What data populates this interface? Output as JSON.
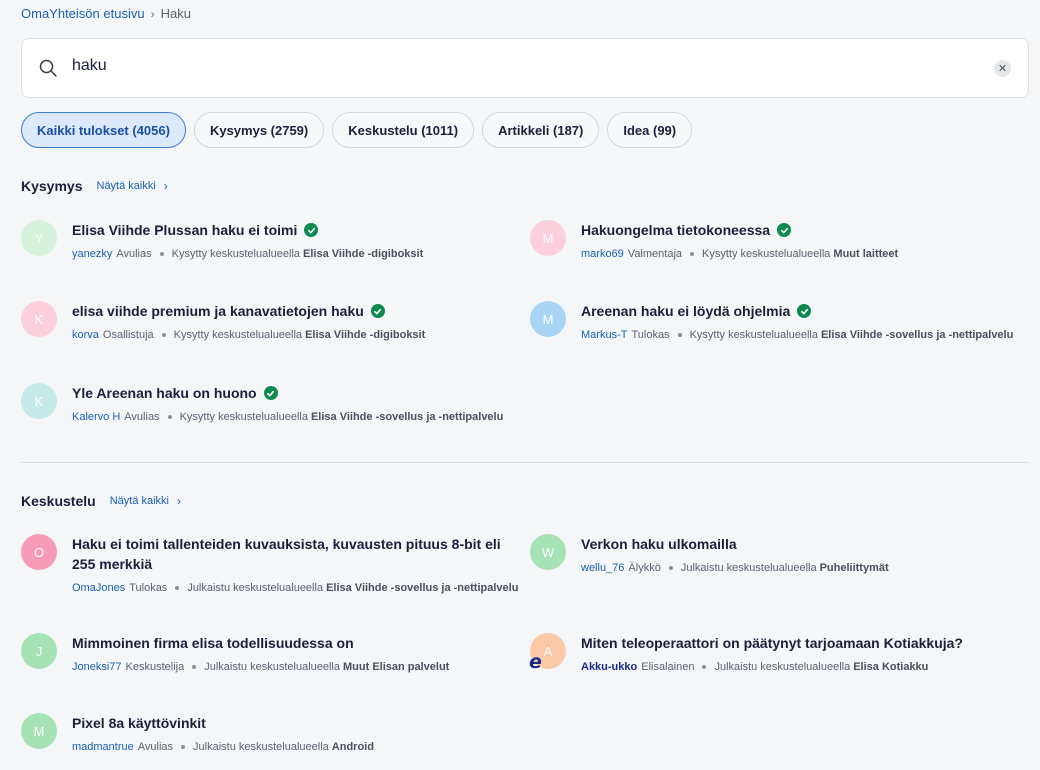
{
  "breadcrumb": {
    "home": "OmaYhteisön etusivu",
    "separator": "›",
    "current": "Haku"
  },
  "search": {
    "value": "haku",
    "clear": "✕"
  },
  "filters": [
    {
      "label": "Kaikki tulokset (4056)",
      "active": true
    },
    {
      "label": "Kysymys (2759)"
    },
    {
      "label": "Keskustelu (1011)"
    },
    {
      "label": "Artikkeli (187)"
    },
    {
      "label": "Idea (99)"
    }
  ],
  "sections": {
    "kysymys": {
      "title": "Kysymys",
      "show_all": "Näytä kaikki",
      "items": [
        {
          "initial": "Y",
          "avatar_color": "#d4f2dc",
          "title": "Elisa Viihde Plussan haku ei toimi",
          "solved": true,
          "user": "yanezky",
          "role": "Avulias",
          "action": "Kysytty keskustelualueella",
          "area": "Elisa Viihde -digiboksit"
        },
        {
          "initial": "M",
          "avatar_color": "#fbd0dc",
          "title": "Hakuongelma tietokoneessa",
          "solved": true,
          "user": "marko69",
          "role": "Valmentaja",
          "action": "Kysytty keskustelualueella",
          "area": "Muut laitteet"
        },
        {
          "initial": "K",
          "avatar_color": "#fbd0dc",
          "title": "elisa viihde premium ja kanavatietojen haku",
          "solved": true,
          "user": "korva",
          "role": "Osallistuja",
          "action": "Kysytty keskustelualueella",
          "area": "Elisa Viihde -digiboksit"
        },
        {
          "initial": "M",
          "avatar_color": "#a9d4f3",
          "title": "Areenan haku ei löydä ohjelmia",
          "solved": true,
          "user": "Markus-T",
          "role": "Tulokas",
          "action": "Kysytty keskustelualueella",
          "area": "Elisa Viihde -sovellus ja -nettipalvelu"
        },
        {
          "initial": "K",
          "avatar_color": "#c4e9e6",
          "title": "Yle Areenan haku on huono",
          "solved": true,
          "user": "Kalervo H",
          "role": "Avulias",
          "action": "Kysytty keskustelualueella",
          "area": "Elisa Viihde -sovellus ja -nettipalvelu"
        }
      ]
    },
    "keskustelu": {
      "title": "Keskustelu",
      "show_all": "Näytä kaikki",
      "items": [
        {
          "initial": "O",
          "avatar_color": "#f79bb8",
          "title": "Haku ei toimi tallenteiden kuvauksista, kuvausten pituus 8-bit eli 255 merkkiä",
          "solved": false,
          "user": "OmaJones",
          "role": "Tulokas",
          "action": "Julkaistu keskustelualueella",
          "area": "Elisa Viihde -sovellus ja -nettipalvelu"
        },
        {
          "initial": "W",
          "avatar_color": "#a6e3b4",
          "title": "Verkon haku ulkomailla",
          "solved": false,
          "user": "wellu_76",
          "role": "Älykkö",
          "action": "Julkaistu keskustelualueella",
          "area": "Puheliittymät"
        },
        {
          "initial": "J",
          "avatar_color": "#a6e3b4",
          "title": "Mimmoinen firma elisa todellisuudessa on",
          "solved": false,
          "user": "Joneksi77",
          "role": "Keskustelija",
          "action": "Julkaistu keskustelualueella",
          "area": "Muut Elisan palvelut"
        },
        {
          "initial": "A",
          "avatar_color": "#fbc9a8",
          "title": "Miten teleoperaattori on päätynyt tarjoamaan Kotiakkuja?",
          "solved": false,
          "user": "Akku-ukko",
          "role": "Elisalainen",
          "action": "Julkaistu keskustelualueella",
          "area": "Elisa Kotiakku",
          "staff": true,
          "logo": "e"
        },
        {
          "initial": "M",
          "avatar_color": "#a6e3b4",
          "title": "Pixel 8a käyttövinkit",
          "solved": false,
          "user": "madmantrue",
          "role": "Avulias",
          "action": "Julkaistu keskustelualueella",
          "area": "Android"
        }
      ]
    }
  }
}
